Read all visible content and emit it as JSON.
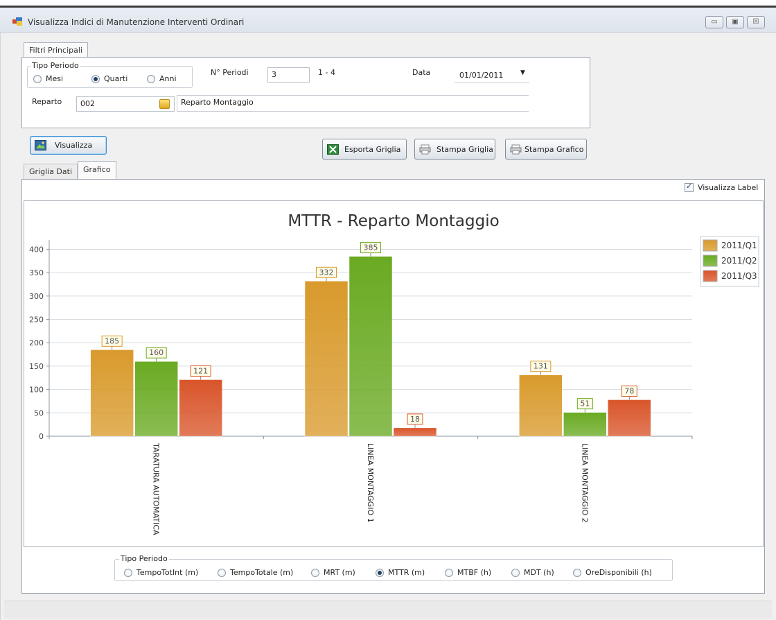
{
  "window": {
    "title": "Visualizza Indici di Manutenzione Interventi Ordinari",
    "controls": {
      "minimize": "▭",
      "maximize": "▣",
      "close": "☒"
    }
  },
  "filters": {
    "tab_label": "Filtri Principali",
    "tipo_periodo_label": "Tipo Periodo",
    "period_options": [
      {
        "label": "Mesi",
        "selected": false
      },
      {
        "label": "Quarti",
        "selected": true
      },
      {
        "label": "Anni",
        "selected": false
      }
    ],
    "n_periodi_label": "N° Periodi",
    "n_periodi_value": "3",
    "n_periodi_range": "1 - 4",
    "data_label": "Data",
    "data_value": "01/01/2011",
    "reparto_label": "Reparto",
    "reparto_code": "002",
    "reparto_name": "Reparto Montaggio"
  },
  "toolbar": {
    "visualizza": "Visualizza",
    "esporta_griglia": "Esporta Griglia",
    "stampa_griglia": "Stampa Griglia",
    "stampa_grafico": "Stampa Grafico"
  },
  "result_tabs": [
    {
      "label": "Griglia Dati",
      "active": false
    },
    {
      "label": "Grafico",
      "active": true
    }
  ],
  "visualizza_label": {
    "label": "Visualizza Label",
    "checked": true
  },
  "chart_data": {
    "type": "bar",
    "title": "MTTR - Reparto Montaggio",
    "categories": [
      "TARATURA AUTOMATICA",
      "LINEA MONTAGGIO 1",
      "LINEA MONTAGGIO 2"
    ],
    "series": [
      {
        "name": "2011/Q1",
        "values": [
          185,
          332,
          131
        ],
        "color": "#d99a2c"
      },
      {
        "name": "2011/Q2",
        "values": [
          160,
          385,
          51
        ],
        "color": "#6aaa22"
      },
      {
        "name": "2011/Q3",
        "values": [
          121,
          18,
          78
        ],
        "color": "#d9552a"
      }
    ],
    "ylim": [
      0,
      420
    ],
    "yticks": [
      "0",
      "50",
      "100",
      "150",
      "200",
      "250",
      "300",
      "350",
      "400"
    ],
    "xlabel": "",
    "ylabel": "",
    "grid": true,
    "legend": "top-right",
    "data_labels": true
  },
  "index_selector": {
    "label": "Tipo Periodo",
    "options": [
      {
        "label": "TempoTotInt (m)",
        "selected": false
      },
      {
        "label": "TempoTotale (m)",
        "selected": false
      },
      {
        "label": "MRT (m)",
        "selected": false
      },
      {
        "label": "MTTR (m)",
        "selected": true
      },
      {
        "label": "MTBF (h)",
        "selected": false
      },
      {
        "label": "MDT (h)",
        "selected": false
      },
      {
        "label": "OreDisponibili (h)",
        "selected": false
      }
    ]
  }
}
